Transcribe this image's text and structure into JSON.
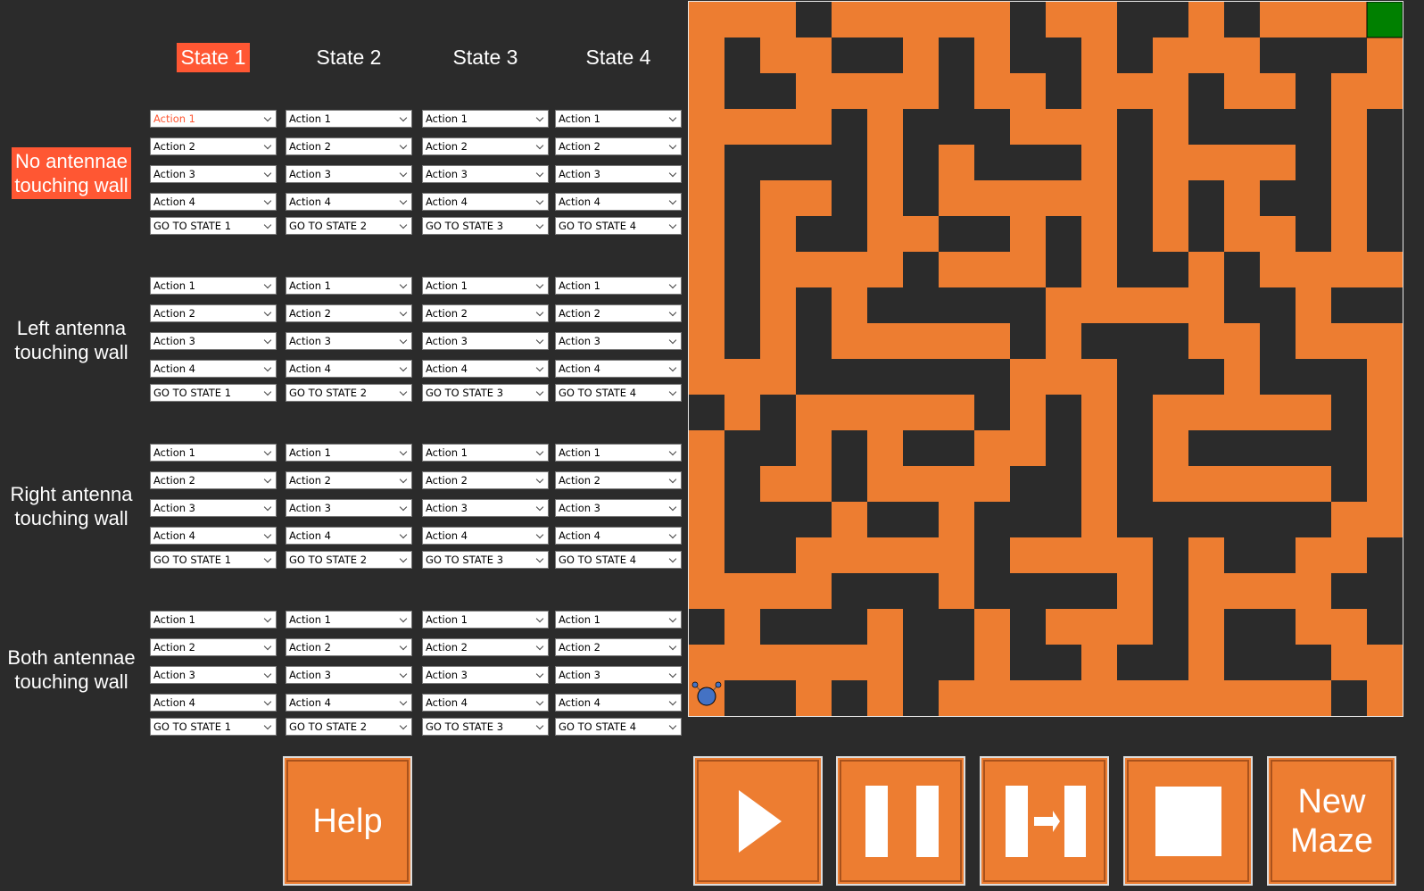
{
  "states": [
    "State 1",
    "State 2",
    "State 3",
    "State 4"
  ],
  "active_state": 0,
  "conditions": [
    {
      "label_line1": "No antennae",
      "label_line2": "touching wall",
      "active": true
    },
    {
      "label_line1": "Left antenna",
      "label_line2": "touching wall",
      "active": false
    },
    {
      "label_line1": "Right antenna",
      "label_line2": "touching wall",
      "active": false
    },
    {
      "label_line1": "Both antennae",
      "label_line2": "touching wall",
      "active": false
    }
  ],
  "grid": [
    [
      [
        "Action 1",
        "Action 2",
        "Action 3",
        "Action 4",
        "GO TO STATE 1"
      ],
      [
        "Action 1",
        "Action 2",
        "Action 3",
        "Action 4",
        "GO TO STATE 2"
      ],
      [
        "Action 1",
        "Action 2",
        "Action 3",
        "Action 4",
        "GO TO STATE 3"
      ],
      [
        "Action 1",
        "Action 2",
        "Action 3",
        "Action 4",
        "GO TO STATE 4"
      ]
    ],
    [
      [
        "Action 1",
        "Action 2",
        "Action 3",
        "Action 4",
        "GO TO STATE 1"
      ],
      [
        "Action 1",
        "Action 2",
        "Action 3",
        "Action 4",
        "GO TO STATE 2"
      ],
      [
        "Action 1",
        "Action 2",
        "Action 3",
        "Action 4",
        "GO TO STATE 3"
      ],
      [
        "Action 1",
        "Action 2",
        "Action 3",
        "Action 4",
        "GO TO STATE 4"
      ]
    ],
    [
      [
        "Action 1",
        "Action 2",
        "Action 3",
        "Action 4",
        "GO TO STATE 1"
      ],
      [
        "Action 1",
        "Action 2",
        "Action 3",
        "Action 4",
        "GO TO STATE 2"
      ],
      [
        "Action 1",
        "Action 2",
        "Action 3",
        "Action 4",
        "GO TO STATE 3"
      ],
      [
        "Action 1",
        "Action 2",
        "Action 3",
        "Action 4",
        "GO TO STATE 4"
      ]
    ],
    [
      [
        "Action 1",
        "Action 2",
        "Action 3",
        "Action 4",
        "GO TO STATE 1"
      ],
      [
        "Action 1",
        "Action 2",
        "Action 3",
        "Action 4",
        "GO TO STATE 2"
      ],
      [
        "Action 1",
        "Action 2",
        "Action 3",
        "Action 4",
        "GO TO STATE 3"
      ],
      [
        "Action 1",
        "Action 2",
        "Action 3",
        "Action 4",
        "GO TO STATE 4"
      ]
    ]
  ],
  "highlight_color": "#ff5733",
  "maze": {
    "path_color": "#ed7d31",
    "wall_color": "#2b2b2b",
    "goal_color": "#008000",
    "robot_color": "#4472c4",
    "rows": [
      "0001000001001101000G",
      "01001101011010001110",
      "01100001001000100100",
      "00001011100010111101",
      "01111010111010000101",
      "01001010000010101101",
      "01011001101010100101",
      "01000010001011010000",
      "01010111110000011011",
      "01010000010111001000",
      "00011111100011101110",
      "10100000101010000010",
      "01101011001010111110",
      "01001000011010000010",
      "01110110111011111100",
      "01100000100001011001",
      "00001110111101000011",
      "10111011010001011001",
      "00000011011011011100",
      "01101010000000000010"
    ],
    "robot": {
      "row": 19,
      "col": 0
    }
  },
  "buttons": {
    "help": "Help",
    "play": "play-icon",
    "pause": "pause-icon",
    "step": "step-icon",
    "stop": "stop-icon",
    "new_maze_line1": "New",
    "new_maze_line2": "Maze"
  }
}
